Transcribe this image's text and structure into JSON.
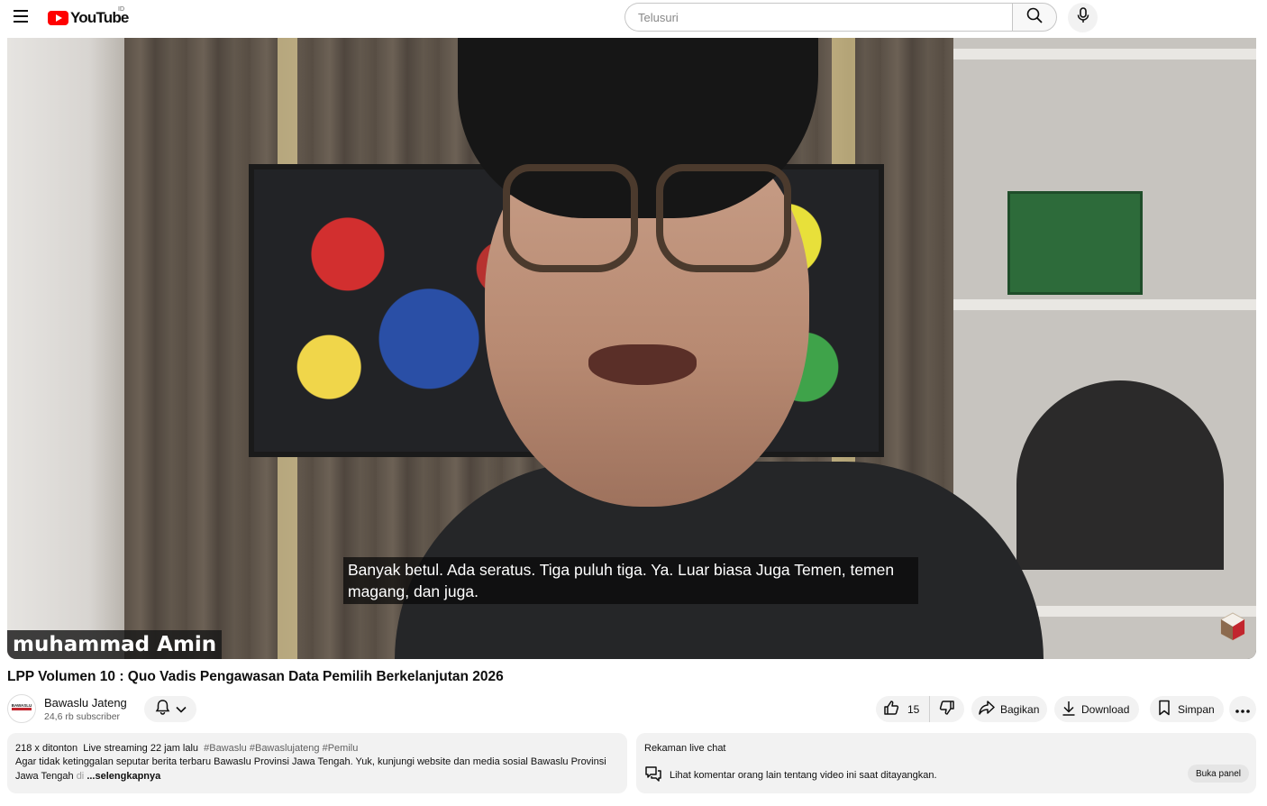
{
  "header": {
    "logo_text": "YouTube",
    "logo_country": "ID",
    "search": {
      "placeholder": "Telusuri",
      "value": ""
    },
    "icons": {
      "menu": "menu-icon",
      "search": "search-icon",
      "mic": "mic-icon"
    }
  },
  "player": {
    "caption_line": "Banyak betul. Ada seratus. Tiga puluh tiga. Ya. Luar biasa Juga Temen, temen magang, dan juga.",
    "speaker_name": "muhammad Amin"
  },
  "video": {
    "title": "LPP Volumen 10 : Quo Vadis Pengawasan Data Pemilih Berkelanjutan 2026"
  },
  "channel": {
    "name": "Bawaslu Jateng",
    "subscribers": "24,6 rb subscriber",
    "avatar_text": "BAWASLU"
  },
  "actions": {
    "like_count": "15",
    "share_label": "Bagikan",
    "download_label": "Download",
    "save_label": "Simpan"
  },
  "description": {
    "views": "218 x ditonton",
    "streamed": "Live streaming 22 jam lalu",
    "tags": "#Bawaslu #Bawaslujateng #Pemilu",
    "text": "Agar tidak ketinggalan seputar berita terbaru Bawaslu Provinsi Jawa Tengah. Yuk, kunjungi website dan media sosial Bawaslu Provinsi Jawa Tengah",
    "text_faded": "di",
    "more_label": "...selengkapnya"
  },
  "live_chat": {
    "title": "Rekaman live chat",
    "message": "Lihat komentar orang lain tentang video ini saat ditayangkan.",
    "open_button": "Buka panel"
  },
  "colors": {
    "brand_red": "#ff0000",
    "chip_bg": "#f2f2f2",
    "text_primary": "#0f0f0f",
    "text_secondary": "#606060"
  }
}
